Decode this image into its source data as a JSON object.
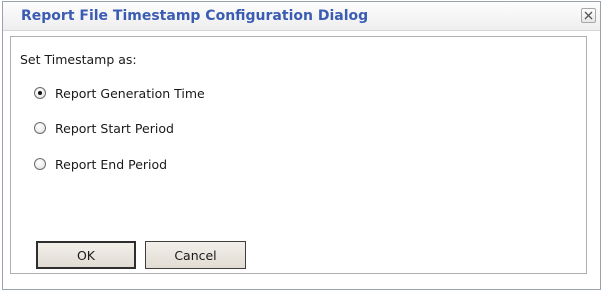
{
  "dialog": {
    "title": "Report File Timestamp Configuration Dialog",
    "close_icon": "close-x-icon",
    "group_label": "Set Timestamp as:",
    "options": [
      {
        "label": "Report Generation Time",
        "checked": true
      },
      {
        "label": "Report Start Period",
        "checked": false
      },
      {
        "label": "Report End Period",
        "checked": false
      }
    ],
    "buttons": {
      "ok_label": "OK",
      "cancel_label": "Cancel"
    }
  },
  "colors": {
    "title_text": "#3a5db3",
    "button_face": "#e9e4dc",
    "border": "#b0b0b0"
  }
}
